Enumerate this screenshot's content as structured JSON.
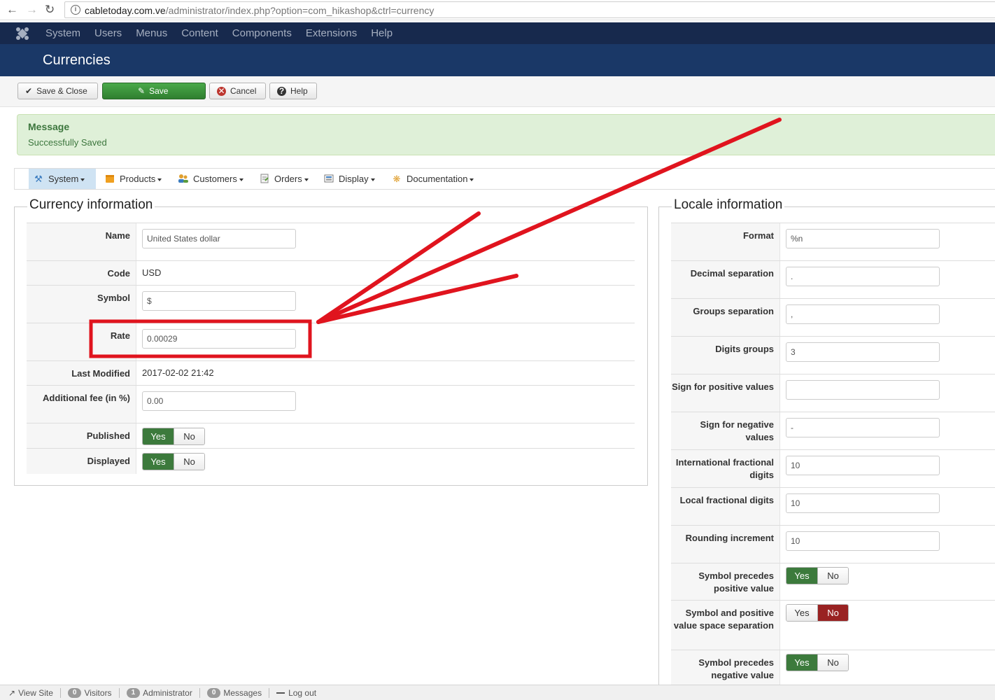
{
  "browser": {
    "url_host": "cabletoday.com.ve",
    "url_path": "/administrator/index.php?option=com_hikashop&ctrl=currency"
  },
  "topnav": {
    "items": [
      "System",
      "Users",
      "Menus",
      "Content",
      "Components",
      "Extensions",
      "Help"
    ]
  },
  "header": {
    "title": "Currencies"
  },
  "toolbar": {
    "save_close": "Save & Close",
    "save": "Save",
    "cancel": "Cancel",
    "help": "Help"
  },
  "message": {
    "title": "Message",
    "text": "Successfully Saved"
  },
  "subnav": {
    "items": [
      "System",
      "Products",
      "Customers",
      "Orders",
      "Display",
      "Documentation"
    ]
  },
  "currency": {
    "legend": "Currency information",
    "name_label": "Name",
    "name_value": "United States dollar",
    "code_label": "Code",
    "code_value": "USD",
    "symbol_label": "Symbol",
    "symbol_value": "$",
    "rate_label": "Rate",
    "rate_value": "0.00029",
    "modified_label": "Last Modified",
    "modified_value": "2017-02-02 21:42",
    "fee_label": "Additional fee (in %)",
    "fee_value": "0.00",
    "published_label": "Published",
    "displayed_label": "Displayed",
    "yes": "Yes",
    "no": "No"
  },
  "locale": {
    "legend": "Locale information",
    "format_label": "Format",
    "format_value": "%n",
    "decimal_label": "Decimal separation",
    "decimal_value": ".",
    "groups_label": "Groups separation",
    "groups_value": ",",
    "digits_groups_label": "Digits groups",
    "digits_groups_value": "3",
    "sign_pos_label": "Sign for positive values",
    "sign_pos_value": "",
    "sign_neg_label": "Sign for negative values",
    "sign_neg_value": "-",
    "intl_frac_label": "International fractional digits",
    "intl_frac_value": "10",
    "local_frac_label": "Local fractional digits",
    "local_frac_value": "10",
    "rounding_label": "Rounding increment",
    "rounding_value": "10",
    "sym_pre_pos_label": "Symbol precedes positive value",
    "sym_space_label": "Symbol and positive value space separation",
    "sym_pre_neg_label": "Symbol precedes negative value",
    "yes": "Yes",
    "no": "No"
  },
  "status": {
    "view_site": "View Site",
    "visitors_count": "0",
    "visitors": "Visitors",
    "admin_count": "1",
    "admin": "Administrator",
    "messages_count": "0",
    "messages": "Messages",
    "logout": "Log out"
  },
  "colors": {
    "topnav_bg": "#17294d",
    "header_bg": "#1a3867",
    "success_green": "#3c7a3c",
    "no_red": "#992222",
    "annotation_red": "#e0141e"
  }
}
